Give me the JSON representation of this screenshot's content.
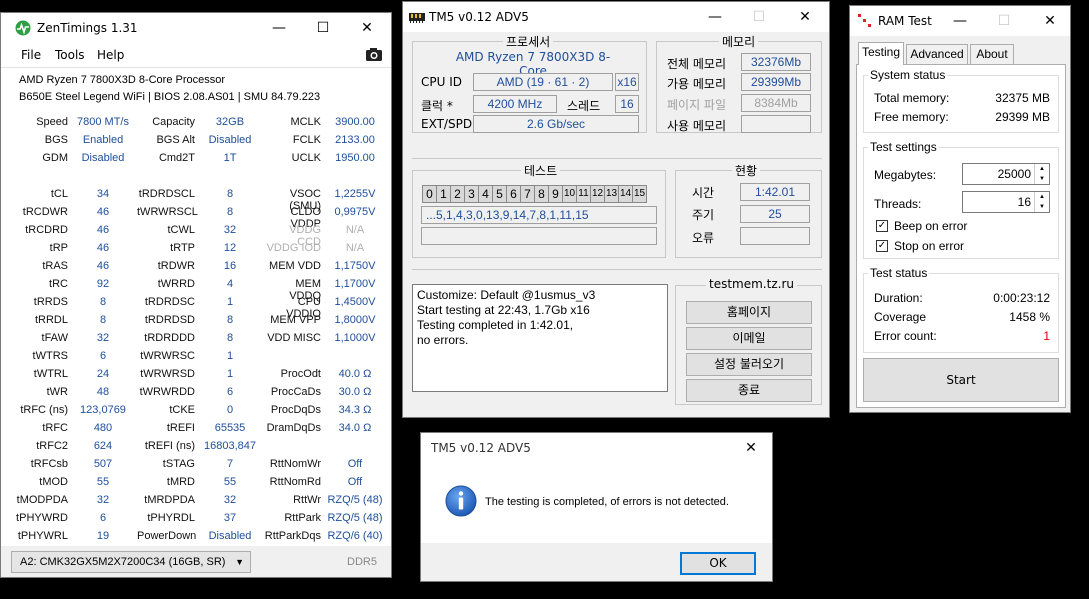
{
  "colors": {
    "value_blue": "#1f4e9a",
    "error_red": "#e00000",
    "zen_green": "#2f9e44"
  },
  "zentimings": {
    "title": "ZenTimings 1.31",
    "menu": [
      "File",
      "Tools",
      "Help"
    ],
    "cpu": "AMD Ryzen 7 7800X3D 8-Core Processor",
    "board": "B650E Steel Legend WiFi | BIOS 2.08.AS01 | SMU 84.79.223",
    "col1": [
      {
        "l": "Speed",
        "v": "7800 MT/s"
      },
      {
        "l": "BGS",
        "v": "Enabled"
      },
      {
        "l": "GDM",
        "v": "Disabled"
      },
      {
        "l": "",
        "v": ""
      },
      {
        "l": "tCL",
        "v": "34"
      },
      {
        "l": "tRCDWR",
        "v": "46"
      },
      {
        "l": "tRCDRD",
        "v": "46"
      },
      {
        "l": "tRP",
        "v": "46"
      },
      {
        "l": "tRAS",
        "v": "46"
      },
      {
        "l": "tRC",
        "v": "92"
      },
      {
        "l": "tRRDS",
        "v": "8"
      },
      {
        "l": "tRRDL",
        "v": "8"
      },
      {
        "l": "tFAW",
        "v": "32"
      },
      {
        "l": "tWTRS",
        "v": "6"
      },
      {
        "l": "tWTRL",
        "v": "24"
      },
      {
        "l": "tWR",
        "v": "48"
      },
      {
        "l": "tRFC (ns)",
        "v": "123,0769"
      },
      {
        "l": "tRFC",
        "v": "480"
      },
      {
        "l": "tRFC2",
        "v": "624"
      },
      {
        "l": "tRFCsb",
        "v": "507"
      },
      {
        "l": "tMOD",
        "v": "55"
      },
      {
        "l": "tMODPDA",
        "v": "32"
      },
      {
        "l": "tPHYWRD",
        "v": "6"
      },
      {
        "l": "tPHYWRL",
        "v": "19"
      }
    ],
    "col2": [
      {
        "l": "Capacity",
        "v": "32GB"
      },
      {
        "l": "BGS Alt",
        "v": "Disabled"
      },
      {
        "l": "Cmd2T",
        "v": "1T"
      },
      {
        "l": "",
        "v": ""
      },
      {
        "l": "tRDRDSCL",
        "v": "8"
      },
      {
        "l": "tWRWRSCL",
        "v": "8"
      },
      {
        "l": "tCWL",
        "v": "32"
      },
      {
        "l": "tRTP",
        "v": "12"
      },
      {
        "l": "tRDWR",
        "v": "16"
      },
      {
        "l": "tWRRD",
        "v": "4"
      },
      {
        "l": "tRDRDSC",
        "v": "1"
      },
      {
        "l": "tRDRDSD",
        "v": "8"
      },
      {
        "l": "tRDRDDD",
        "v": "8"
      },
      {
        "l": "tWRWRSC",
        "v": "1"
      },
      {
        "l": "tWRWRSD",
        "v": "1"
      },
      {
        "l": "tWRWRDD",
        "v": "6"
      },
      {
        "l": "tCKE",
        "v": "0"
      },
      {
        "l": "tREFI",
        "v": "65535"
      },
      {
        "l": "tREFI (ns)",
        "v": "16803,847"
      },
      {
        "l": "tSTAG",
        "v": "7"
      },
      {
        "l": "tMRD",
        "v": "55"
      },
      {
        "l": "tMRDPDA",
        "v": "32"
      },
      {
        "l": "tPHYRDL",
        "v": "37"
      },
      {
        "l": "PowerDown",
        "v": "Disabled"
      }
    ],
    "col3": [
      {
        "l": "MCLK",
        "v": "3900.00"
      },
      {
        "l": "FCLK",
        "v": "2133.00"
      },
      {
        "l": "UCLK",
        "v": "1950.00"
      },
      {
        "l": "",
        "v": ""
      },
      {
        "l": "VSOC (SMU)",
        "v": "1,2255V"
      },
      {
        "l": "CLDO VDDP",
        "v": "0,9975V"
      },
      {
        "l": "VDDG CCD",
        "v": "N/A"
      },
      {
        "l": "VDDG IOD",
        "v": "N/A"
      },
      {
        "l": "MEM VDD",
        "v": "1,1750V"
      },
      {
        "l": "MEM VDDQ",
        "v": "1,1700V"
      },
      {
        "l": "CPU VDDIO",
        "v": "1,4500V"
      },
      {
        "l": "MEM VPP",
        "v": "1,8000V"
      },
      {
        "l": "VDD MISC",
        "v": "1,1000V"
      },
      {
        "l": "",
        "v": ""
      },
      {
        "l": "ProcOdt",
        "v": "40.0 Ω"
      },
      {
        "l": "ProcCaDs",
        "v": "30.0 Ω"
      },
      {
        "l": "ProcDqDs",
        "v": "34.3 Ω"
      },
      {
        "l": "DramDqDs",
        "v": "34.0 Ω"
      },
      {
        "l": "",
        "v": ""
      },
      {
        "l": "RttNomWr",
        "v": "Off"
      },
      {
        "l": "RttNomRd",
        "v": "Off"
      },
      {
        "l": "RttWr",
        "v": "RZQ/5 (48)"
      },
      {
        "l": "RttPark",
        "v": "RZQ/5 (48)"
      },
      {
        "l": "RttParkDqs",
        "v": "RZQ/6 (40)"
      }
    ],
    "module": "A2: CMK32GX5M2X7200C34 (16GB, SR)",
    "ddr": "DDR5"
  },
  "tm5": {
    "title": "TM5 v0.12 ADV5",
    "processor_title": "프로세서",
    "processor_name": "AMD Ryzen 7 7800X3D 8-Core",
    "cpu_id_label": "CPU ID",
    "cpu_id_value": "AMD  (19 · 61 · 2)",
    "threads_x": "x16",
    "clock_label": "클럭 *",
    "clock_value": "4200 MHz",
    "thread_label": "스레드",
    "thread_value": "16",
    "ext_label": "EXT/SPD",
    "ext_value": "2.6 Gb/sec",
    "memory_title": "메모리",
    "total_label": "전체 메모리",
    "total_value": "32376Mb",
    "avail_label": "가용 메모리",
    "avail_value": "29399Mb",
    "page_label": "페이지 파일",
    "page_value": "8384Mb",
    "used_label": "사용 메모리",
    "used_value": "",
    "test_title": "테스트",
    "test_cells": [
      "0",
      "1",
      "2",
      "3",
      "4",
      "5",
      "6",
      "7",
      "8",
      "9",
      "10",
      "11",
      "12",
      "13",
      "14",
      "15"
    ],
    "sequence": "...5,1,4,3,0,13,9,14,7,8,1,11,15",
    "status_title": "현황",
    "time_label": "시간",
    "time_value": "1:42.01",
    "cycle_label": "주기",
    "cycle_value": "25",
    "error_label": "오류",
    "error_value": "",
    "log": [
      "Customize: Default @1usmus_v3",
      "Start testing at 22:43, 1.7Gb x16",
      "Testing completed in 1:42.01,",
      "no errors."
    ],
    "site_title": "testmem.tz.ru",
    "buttons": [
      "홈페이지",
      "이메일",
      "설정 불러오기",
      "종료"
    ]
  },
  "dialog": {
    "title": "TM5 v0.12 ADV5",
    "message": "The testing is completed, of errors is not detected.",
    "ok": "OK"
  },
  "ramtest": {
    "title": "RAM Test",
    "tabs": [
      "Testing",
      "Advanced",
      "About"
    ],
    "system_status": "System status",
    "total_label": "Total memory:",
    "total_value": "32375 MB",
    "free_label": "Free memory:",
    "free_value": "29399 MB",
    "test_settings": "Test settings",
    "megabytes_label": "Megabytes:",
    "megabytes_value": "25000",
    "threads_label": "Threads:",
    "threads_value": "16",
    "beep_label": "Beep on error",
    "stop_label": "Stop on error",
    "test_status": "Test status",
    "duration_label": "Duration:",
    "duration_value": "0:00:23:12",
    "coverage_label": "Coverage",
    "coverage_value": "1458 %",
    "errors_label": "Error count:",
    "errors_value": "1",
    "start": "Start"
  }
}
